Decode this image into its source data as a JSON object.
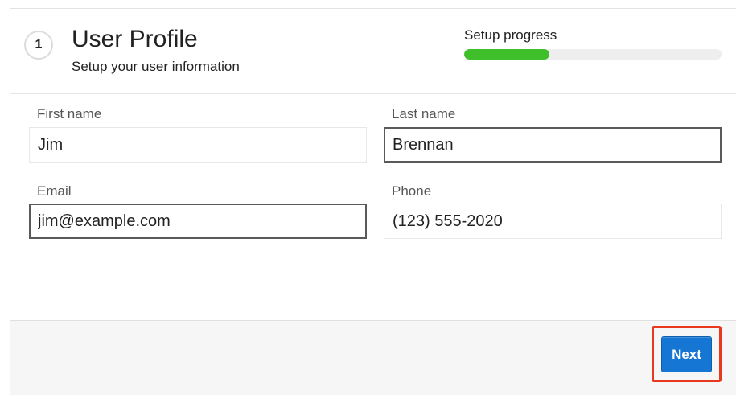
{
  "header": {
    "step_number": "1",
    "title": "User Profile",
    "subtitle": "Setup your user information"
  },
  "progress": {
    "label": "Setup progress",
    "value": 0.33,
    "color": "#3fbf2a"
  },
  "form": {
    "first_name": {
      "label": "First name",
      "value": "Jim"
    },
    "last_name": {
      "label": "Last name",
      "value": "Brennan"
    },
    "email": {
      "label": "Email",
      "value": "jim@example.com"
    },
    "phone": {
      "label": "Phone",
      "value": "(123) 555-2020"
    }
  },
  "footer": {
    "next_label": "Next",
    "next_color": "#1676d3",
    "highlight_color": "#e8391f"
  }
}
